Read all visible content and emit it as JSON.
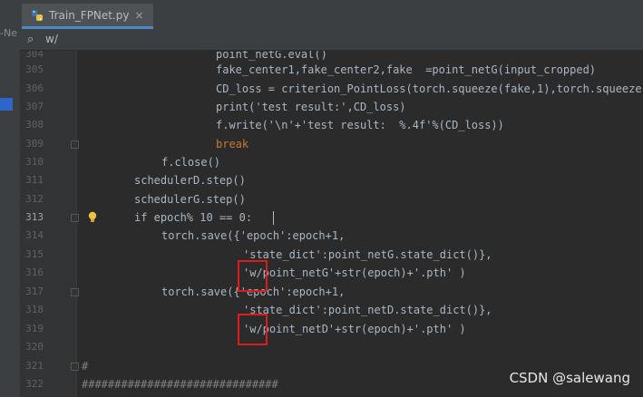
{
  "tab": {
    "title": "Train_FPNet.py",
    "close": "×",
    "icon": "python-file-icon"
  },
  "left_panel": {
    "label": "-Ne"
  },
  "search": {
    "icon": "search-icon",
    "query": "w/"
  },
  "editor": {
    "current_line": "313",
    "lines": [
      {
        "num": "304",
        "text": "point_netG.eval()"
      },
      {
        "num": "305",
        "text": "fake_center1,fake_center2,fake  =point_netG(input_cropped)"
      },
      {
        "num": "306",
        "text": "CD_loss = criterion_PointLoss(torch.squeeze(fake,1),torch.squeeze"
      },
      {
        "num": "307",
        "text": "print('test result:',CD_loss)"
      },
      {
        "num": "308",
        "text": "f.write('\\n'+'test result:  %.4f'%(CD_loss))"
      },
      {
        "num": "309",
        "text": "break"
      },
      {
        "num": "310",
        "text": "f.close()"
      },
      {
        "num": "311",
        "text": "schedulerD.step()"
      },
      {
        "num": "312",
        "text": "schedulerG.step()"
      },
      {
        "num": "313",
        "text": "if epoch% 10 == 0:"
      },
      {
        "num": "314",
        "text": "torch.save({'epoch':epoch+1,"
      },
      {
        "num": "315",
        "text": "'state_dict':point_netG.state_dict()},"
      },
      {
        "num": "316",
        "text": "'w/point_netG'+str(epoch)+'.pth' )"
      },
      {
        "num": "317",
        "text": "torch.save({'epoch':epoch+1,"
      },
      {
        "num": "318",
        "text": "'state_dict':point_netD.state_dict()},"
      },
      {
        "num": "319",
        "text": "'w/point_netD'+str(epoch)+'.pth' )"
      },
      {
        "num": "320",
        "text": ""
      },
      {
        "num": "321",
        "text": "#"
      },
      {
        "num": "322",
        "text": "##############################"
      }
    ]
  },
  "watermark": "CSDN @salewang",
  "colors": {
    "background": "#2b2b2b",
    "string": "#6a8759",
    "keyword": "#cc7832",
    "number": "#6897bb",
    "highlight_box": "#e01b1b"
  }
}
